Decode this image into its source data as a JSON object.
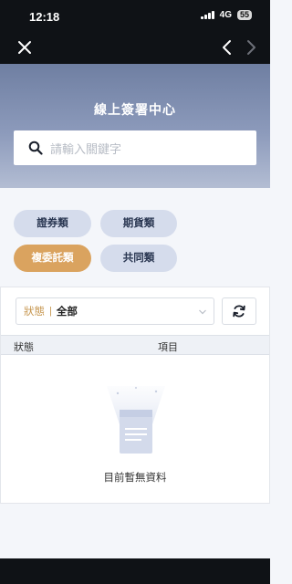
{
  "status_bar": {
    "time": "12:18",
    "network": "4G",
    "battery": "55"
  },
  "nav": {
    "close_icon": "close-icon",
    "back_icon": "chevron-left-icon",
    "forward_icon": "chevron-right-icon"
  },
  "hero": {
    "title": "線上簽署中心"
  },
  "search": {
    "placeholder": "請輸入關鍵字"
  },
  "categories": [
    {
      "label": "證券類",
      "active": false
    },
    {
      "label": "期貨類",
      "active": false
    },
    {
      "label": "複委託類",
      "active": true
    },
    {
      "label": "共同類",
      "active": false
    }
  ],
  "filter": {
    "label": "狀態",
    "separator": "|",
    "value": "全部"
  },
  "table": {
    "col_status": "狀態",
    "col_item": "項目"
  },
  "empty": {
    "text": "目前暫無資料"
  },
  "colors": {
    "accent": "#daa35f",
    "chip": "#d5dcec",
    "dark": "#0f1216"
  }
}
